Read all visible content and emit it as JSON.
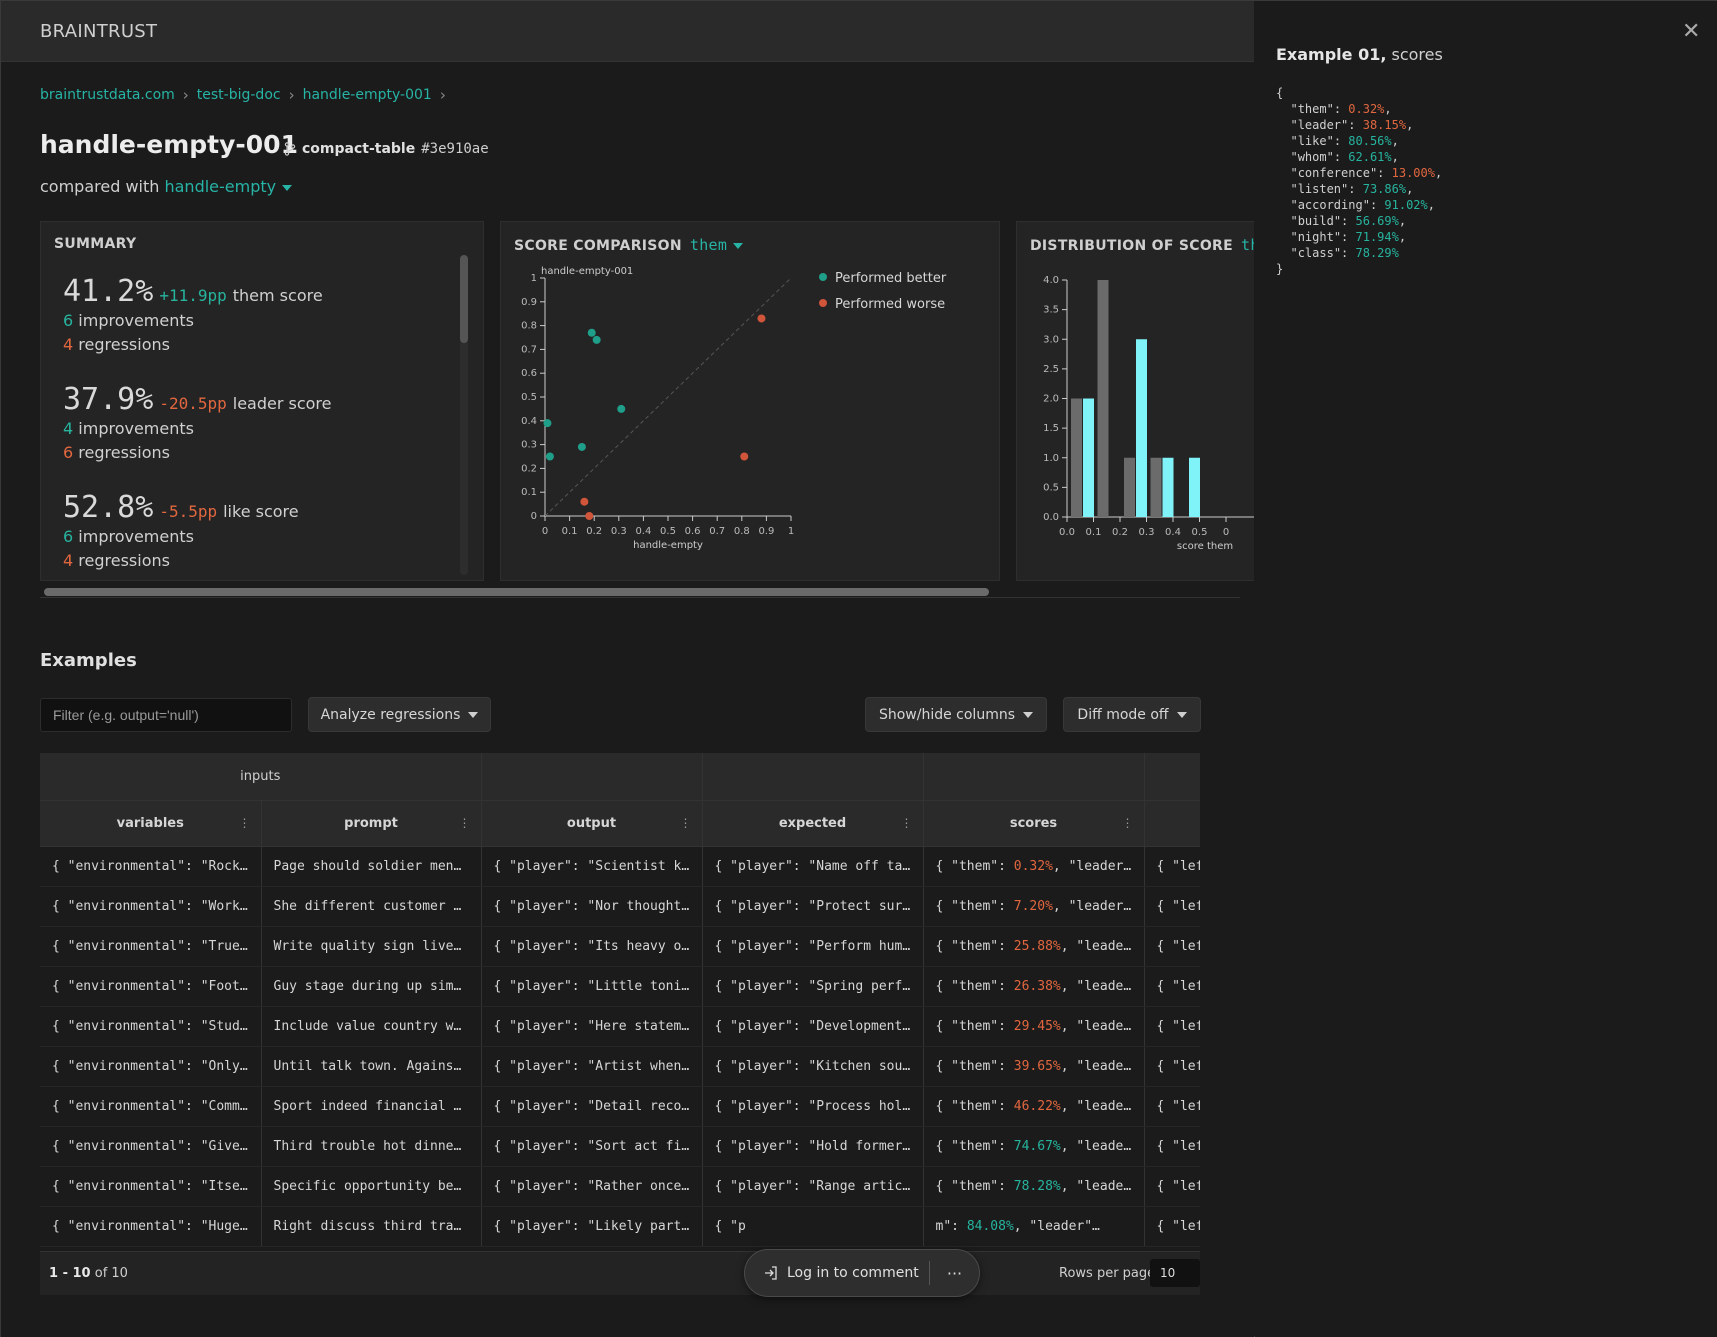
{
  "app": {
    "brand": "BRAINTRUST"
  },
  "breadcrumb": [
    {
      "label": "braintrustdata.com"
    },
    {
      "label": "test-big-doc"
    },
    {
      "label": "handle-empty-001"
    }
  ],
  "experiment": {
    "title": "handle-empty-001",
    "branch": "compact-table",
    "commit": "#3e910ae",
    "compared_prefix": "compared with",
    "compared_with": "handle-empty"
  },
  "summary": {
    "title": "SUMMARY",
    "scores": [
      {
        "value": "41.2%",
        "delta": "+11.9pp",
        "label": "them score",
        "improvements": "6",
        "regressions": "4",
        "positive": true
      },
      {
        "value": "37.9%",
        "delta": "-20.5pp",
        "label": "leader score",
        "improvements": "4",
        "regressions": "6",
        "positive": false
      },
      {
        "value": "52.8%",
        "delta": "-5.5pp",
        "label": "like score",
        "improvements": "6",
        "regressions": "4",
        "positive": false
      }
    ],
    "improvements_word": "improvements",
    "regressions_word": "regressions"
  },
  "compare_panel": {
    "title": "SCORE COMPARISON",
    "selected": "them"
  },
  "distrib_panel": {
    "title": "DISTRIBUTION OF SCORE",
    "selected": "them"
  },
  "chart_data": [
    {
      "type": "scatter",
      "title": "SCORE COMPARISON",
      "xlabel": "handle-empty",
      "ylabel": "handle-empty-001",
      "xlim": [
        0,
        1
      ],
      "ylim": [
        0,
        1
      ],
      "xticks": [
        "0",
        "0.1",
        "0.2",
        "0.3",
        "0.4",
        "0.5",
        "0.6",
        "0.7",
        "0.8",
        "0.9",
        "1"
      ],
      "yticks": [
        "0",
        "0.1",
        "0.2",
        "0.3",
        "0.4",
        "0.5",
        "0.6",
        "0.7",
        "0.8",
        "0.9",
        "1"
      ],
      "legend_position": "top-right",
      "series": [
        {
          "name": "Performed better",
          "color": "#1f9e89",
          "x": [
            0.01,
            0.02,
            0.15,
            0.19,
            0.21,
            0.31
          ],
          "y": [
            0.39,
            0.25,
            0.29,
            0.77,
            0.74,
            0.45
          ]
        },
        {
          "name": "Performed worse",
          "color": "#d0553a",
          "x": [
            0.16,
            0.18,
            0.81,
            0.88
          ],
          "y": [
            0.06,
            0.0,
            0.25,
            0.83
          ]
        }
      ]
    },
    {
      "type": "bar",
      "title": "DISTRIBUTION OF SCORE",
      "xlabel": "score them",
      "ylim": [
        0,
        4.0
      ],
      "xlim": [
        0,
        0.6
      ],
      "xticks": [
        "0.0",
        "0.1",
        "0.2",
        "0.3",
        "0.4",
        "0.5",
        "0"
      ],
      "yticks": [
        "0.0",
        "0.5",
        "1.0",
        "1.5",
        "2.0",
        "2.5",
        "3.0",
        "3.5",
        "4.0"
      ],
      "bins": [
        0.0,
        0.1,
        0.2,
        0.3,
        0.4,
        0.5
      ],
      "series": [
        {
          "color": "#6b6b6b",
          "values": [
            2,
            4,
            1,
            1,
            0,
            0
          ]
        },
        {
          "color": "#7ff3f7",
          "values": [
            2,
            0,
            3,
            1,
            1,
            0
          ]
        }
      ]
    }
  ],
  "examples": {
    "heading": "Examples",
    "filter_placeholder": "Filter (e.g. output='null')",
    "buttons": {
      "analyze": "Analyze regressions",
      "columns": "Show/hide columns",
      "diff": "Diff mode off"
    },
    "group_label": "inputs",
    "columns": [
      "variables",
      "prompt",
      "output",
      "expected",
      "scores",
      ""
    ],
    "rows": [
      {
        "variables": "{ \"environmental\": \"Rock s…",
        "prompt": "Page should soldier mentio…",
        "output": "{ \"player\": \"Scientist kno…",
        "expected": "{ \"player\": \"Name off task…",
        "score_pre": "{ \"them\": ",
        "score_val": "0.32%",
        "score_post": ", \"leader\":…",
        "neg": true,
        "extra": "{ \"lef"
      },
      {
        "variables": "{ \"environmental\": \"Worker…",
        "prompt": "She different customer spe…",
        "output": "{ \"player\": \"Nor thought d…",
        "expected": "{ \"player\": \"Protect sure …",
        "score_pre": "{ \"them\": ",
        "score_val": "7.20%",
        "score_post": ", \"leader\":…",
        "neg": true,
        "extra": "{ \"lef"
      },
      {
        "variables": "{ \"environmental\": \"True c…",
        "prompt": "Write quality sign live wa…",
        "output": "{ \"player\": \"Its heavy ok …",
        "expected": "{ \"player\": \"Perform human…",
        "score_pre": "{ \"them\": ",
        "score_val": "25.88%",
        "score_post": ", \"leader\"…",
        "neg": true,
        "extra": "{ \"lef"
      },
      {
        "variables": "{ \"environmental\": \"Foot q…",
        "prompt": "Guy stage during up simila…",
        "output": "{ \"player\": \"Little tonigh…",
        "expected": "{ \"player\": \"Spring perfor…",
        "score_pre": "{ \"them\": ",
        "score_val": "26.38%",
        "score_post": ", \"leader\"…",
        "neg": true,
        "extra": "{ \"lef"
      },
      {
        "variables": "{ \"environmental\": \"Study …",
        "prompt": "Include value country with…",
        "output": "{ \"player\": \"Here statemen…",
        "expected": "{ \"player\": \"Development c…",
        "score_pre": "{ \"them\": ",
        "score_val": "29.45%",
        "score_post": ", \"leader\"…",
        "neg": true,
        "extra": "{ \"lef"
      },
      {
        "variables": "{ \"environmental\": \"Only e…",
        "prompt": "Until talk town. Against r…",
        "output": "{ \"player\": \"Artist when s…",
        "expected": "{ \"player\": \"Kitchen south…",
        "score_pre": "{ \"them\": ",
        "score_val": "39.65%",
        "score_post": ", \"leader\"…",
        "neg": true,
        "extra": "{ \"lef"
      },
      {
        "variables": "{ \"environmental\": \"Common…",
        "prompt": "Sport indeed financial smi…",
        "output": "{ \"player\": \"Detail record…",
        "expected": "{ \"player\": \"Process hold …",
        "score_pre": "{ \"them\": ",
        "score_val": "46.22%",
        "score_post": ", \"leader\"…",
        "neg": true,
        "extra": "{ \"lef"
      },
      {
        "variables": "{ \"environmental\": \"Give s…",
        "prompt": "Third trouble hot dinner r…",
        "output": "{ \"player\": \"Sort act figh…",
        "expected": "{ \"player\": \"Hold former c…",
        "score_pre": "{ \"them\": ",
        "score_val": "74.67%",
        "score_post": ", \"leader\"…",
        "neg": false,
        "extra": "{ \"lef"
      },
      {
        "variables": "{ \"environmental\": \"Itself…",
        "prompt": "Specific opportunity beyon…",
        "output": "{ \"player\": \"Rather once t…",
        "expected": "{ \"player\": \"Range article…",
        "score_pre": "{ \"them\": ",
        "score_val": "78.28%",
        "score_post": ", \"leader\"…",
        "neg": false,
        "extra": "{ \"lef"
      },
      {
        "variables": "{ \"environmental\": \"Huge n…",
        "prompt": "Right discuss third tradit…",
        "output": "{ \"player\": \"Likely partne…",
        "expected": "{ \"p",
        "score_pre": "m\": ",
        "score_val": "84.08%",
        "score_post": ", \"leader\"…",
        "neg": false,
        "extra": "{ \"lef"
      }
    ],
    "pager": {
      "range": "1 - 10",
      "of": "of 10",
      "rows_per_page_label": "Rows per page:",
      "rows_per_page": "10"
    }
  },
  "comment": {
    "login": "Log in to comment",
    "more": "···"
  },
  "side": {
    "title_bold": "Example 01,",
    "title_rest": " scores",
    "json": [
      {
        "key": "them",
        "val": "0.32%",
        "neg": true
      },
      {
        "key": "leader",
        "val": "38.15%",
        "neg": true
      },
      {
        "key": "like",
        "val": "80.56%",
        "neg": false
      },
      {
        "key": "whom",
        "val": "62.61%",
        "neg": false
      },
      {
        "key": "conference",
        "val": "13.00%",
        "neg": true
      },
      {
        "key": "listen",
        "val": "73.86%",
        "neg": false
      },
      {
        "key": "according",
        "val": "91.02%",
        "neg": false
      },
      {
        "key": "build",
        "val": "56.69%",
        "neg": false
      },
      {
        "key": "night",
        "val": "71.94%",
        "neg": false
      },
      {
        "key": "class",
        "val": "78.29%",
        "neg": false
      }
    ]
  }
}
